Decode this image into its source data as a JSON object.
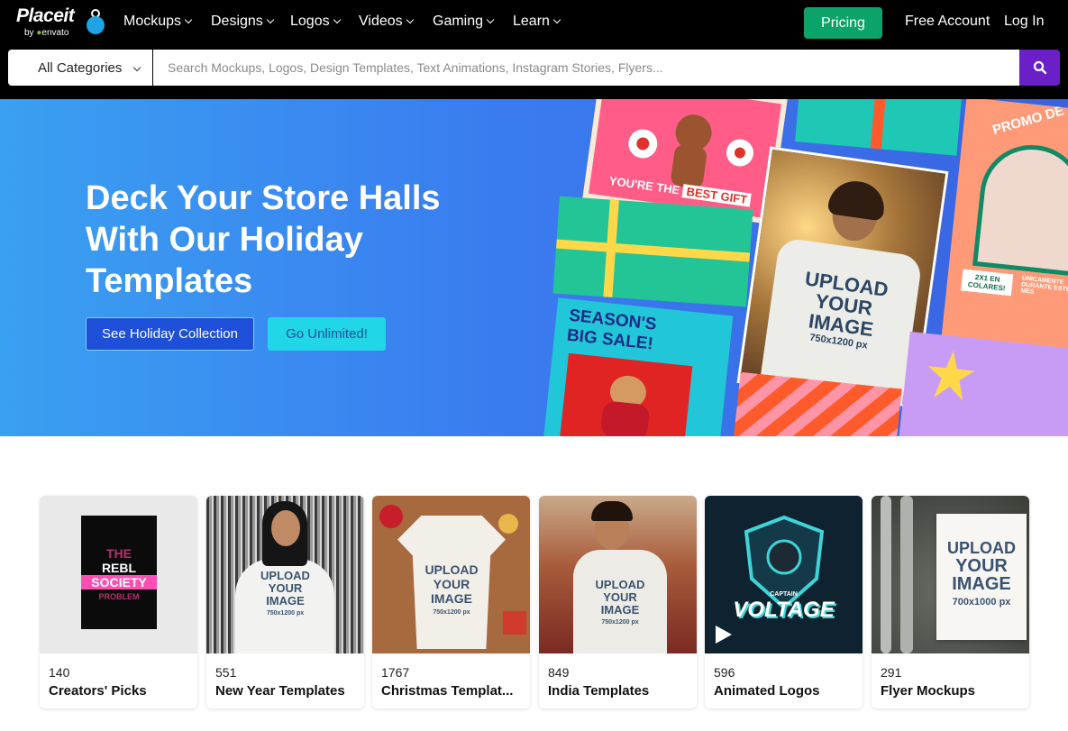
{
  "brand": {
    "name": "Placeit",
    "by": "by",
    "partner": "envato"
  },
  "nav": {
    "items": [
      {
        "label": "Mockups"
      },
      {
        "label": "Designs"
      },
      {
        "label": "Logos"
      },
      {
        "label": "Videos"
      },
      {
        "label": "Gaming"
      },
      {
        "label": "Learn"
      }
    ],
    "pricing": "Pricing",
    "free_account": "Free Account",
    "login": "Log In"
  },
  "search": {
    "category": "All Categories",
    "placeholder": "Search Mockups, Logos, Design Templates, Text Animations, Instagram Stories, Flyers..."
  },
  "hero": {
    "title": "Deck Your Store Halls With Our Holiday Templates",
    "cta_primary": "See Holiday Collection",
    "cta_secondary": "Go Unlimited!",
    "art": {
      "card1_line1": "YOU'RE THE",
      "card1_line2": "BEST GIFT",
      "card2_line1": "SEASON'S",
      "card2_line2": "BIG SALE!",
      "card3_promo": "PROMO DE",
      "card3_left": "2X1 EN COLARES!",
      "card3_right": "ÚNICAMENTE DURANTE ESTE MES",
      "upload_line1": "UPLOAD",
      "upload_line2": "YOUR",
      "upload_line3": "IMAGE",
      "upload_size": "750x1200 px"
    }
  },
  "categories": [
    {
      "count": "140",
      "label": "Creators' Picks",
      "art": {
        "line1": "THE",
        "line2": "REBL",
        "line3": "SOCIETY",
        "line4": "PROBLEM"
      }
    },
    {
      "count": "551",
      "label": "New Year Templates",
      "art": {
        "line1": "UPLOAD",
        "line2": "YOUR",
        "line3": "IMAGE",
        "size": "750x1200 px"
      }
    },
    {
      "count": "1767",
      "label": "Christmas Templat...",
      "art": {
        "line1": "UPLOAD",
        "line2": "YOUR",
        "line3": "IMAGE",
        "size": "750x1200 px"
      }
    },
    {
      "count": "849",
      "label": "India Templates",
      "art": {
        "line1": "UPLOAD",
        "line2": "YOUR",
        "line3": "IMAGE",
        "size": "750x1200 px"
      }
    },
    {
      "count": "596",
      "label": "Animated Logos",
      "art": {
        "line1": "CAPTAIN",
        "line2": "VOLTAGE"
      }
    },
    {
      "count": "291",
      "label": "Flyer Mockups",
      "art": {
        "line1": "UPLOAD",
        "line2": "YOUR",
        "line3": "IMAGE",
        "size": "700x1000 px"
      }
    }
  ]
}
